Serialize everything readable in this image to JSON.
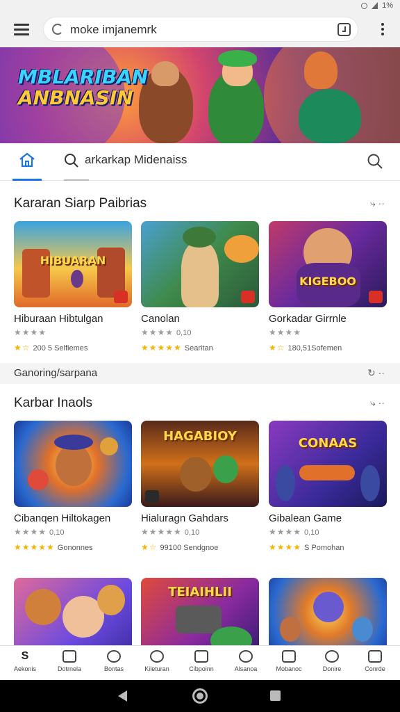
{
  "status_bar": {
    "battery": "1%"
  },
  "browser": {
    "url": "moke imjanemrk"
  },
  "banner": {
    "title_line1": "MBLARIBAN",
    "title_line2": "ANBNASIN"
  },
  "tabs": {
    "search_label": "arkarkap Midenaiss"
  },
  "section1": {
    "title": "Kararan Siarp Paibrias",
    "cards": [
      {
        "name": "Hiburaan Hibtulgan",
        "thumb_text": "HIBUARAN",
        "rating_text": "",
        "count_text": "200 5 Selfiemes"
      },
      {
        "name": "Canolan",
        "thumb_text": "",
        "rating_text": "0,10",
        "count_text": "Searitan"
      },
      {
        "name": "Gorkadar Girrnle",
        "thumb_text": "KIGEBOO",
        "rating_text": "",
        "count_text": "180,51Sofemen"
      }
    ]
  },
  "subrow": {
    "title": "Ganoring/sarpana"
  },
  "section2": {
    "title": "Karbar Inaols",
    "cards": [
      {
        "name": "Cibanqen Hiltokagen",
        "thumb_text": "",
        "rating_text": "0,10",
        "count_text": "Gononnes"
      },
      {
        "name": "Hialuragn Gahdars",
        "thumb_text": "HAGABIOY",
        "rating_text": "0,10",
        "count_text": "99100 Sendgnoe"
      },
      {
        "name": "Gibalean Game",
        "thumb_text": "CONAAS",
        "rating_text": "0,10",
        "count_text": "S Pomohan"
      }
    ]
  },
  "section3": {
    "cards": [
      {
        "thumb_text": ""
      },
      {
        "thumb_text": "TEIAIHLII"
      },
      {
        "thumb_text": ""
      }
    ]
  },
  "bottom_nav": [
    {
      "icon": "s-icon",
      "label": "Aekonis"
    },
    {
      "icon": "map-icon",
      "label": "Dotrnela"
    },
    {
      "icon": "chat-icon",
      "label": "Bontas"
    },
    {
      "icon": "clock-icon",
      "label": "Kileturan"
    },
    {
      "icon": "calendar-icon",
      "label": "Cibpoinn"
    },
    {
      "icon": "profile-icon",
      "label": "Alsanoa"
    },
    {
      "icon": "box-icon",
      "label": "Mobanoc"
    },
    {
      "icon": "group-icon",
      "label": "Donire"
    },
    {
      "icon": "stack-icon",
      "label": "Conrde"
    }
  ],
  "colors": {
    "accent": "#1a73e8",
    "star": "#f4b400"
  }
}
